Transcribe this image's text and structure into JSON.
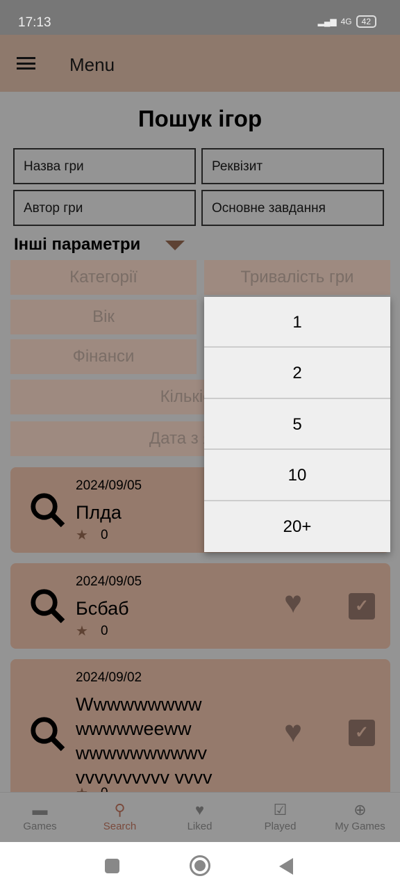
{
  "status": {
    "time": "17:13",
    "battery": "42",
    "network": "4G"
  },
  "appbar": {
    "title": "Menu"
  },
  "page_title": "Пошук ігор",
  "fields": {
    "name": "Назва гри",
    "props": "Реквізит",
    "author": "Автор гри",
    "task": "Основне завдання"
  },
  "more_params": "Інші параметри",
  "chips": {
    "categories": "Категорії",
    "duration": "Тривалість гри",
    "age": "Вік",
    "finance": "Фінанси",
    "count": "Кількість у",
    "date": "Дата з якої ш"
  },
  "dropdown": {
    "options": [
      "1",
      "2",
      "5",
      "10",
      "20+"
    ]
  },
  "cards": [
    {
      "date": "2024/09/05",
      "name": "Плда",
      "rating": "0"
    },
    {
      "date": "2024/09/05",
      "name": "Бсбаб",
      "rating": "0"
    },
    {
      "date": "2024/09/02",
      "name": "Wwwwwwwww wwwwweeww wwwwwwwwwv vvvvvvvvvv vvvv",
      "rating": "0"
    }
  ],
  "bottom_nav": [
    {
      "label": "Games",
      "icon": "folder-icon"
    },
    {
      "label": "Search",
      "icon": "search-icon",
      "active": true
    },
    {
      "label": "Liked",
      "icon": "heart-icon"
    },
    {
      "label": "Played",
      "icon": "checkbox-icon"
    },
    {
      "label": "My Games",
      "icon": "add-circle-icon"
    }
  ],
  "colors": {
    "appbar": "#8e796c",
    "card": "#957a6c",
    "accent": "#7a4a3c"
  }
}
